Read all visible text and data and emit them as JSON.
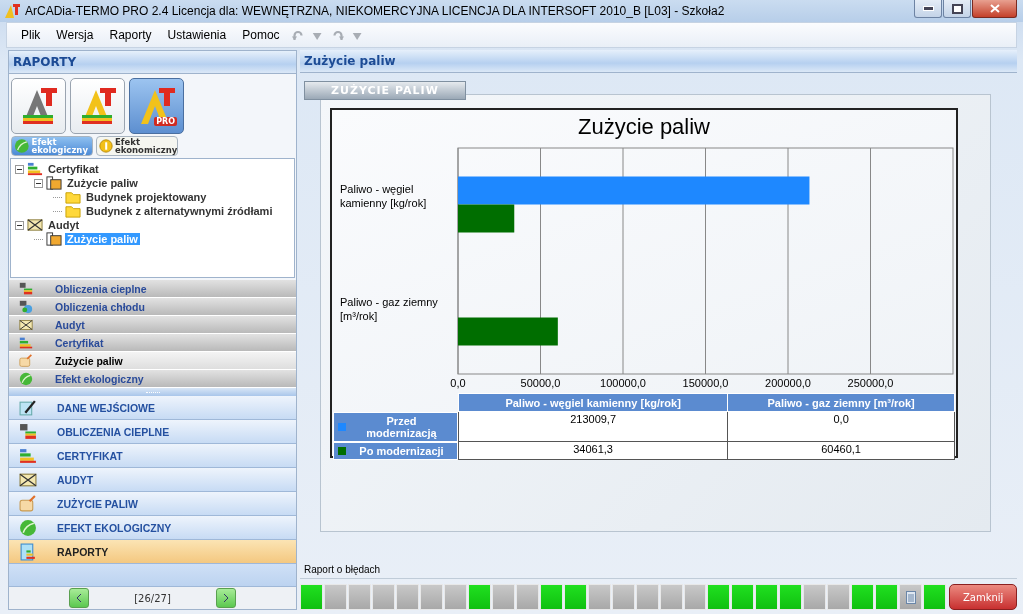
{
  "window": {
    "title": "ArCADia-TERMO PRO 2.4 Licencja dla: WEWNĘTRZNA, NIEKOMERCYJNA LICENCJA DLA INTERSOFT 2010_B [L03] - Szkoła2"
  },
  "menu": [
    "Plik",
    "Wersja",
    "Raporty",
    "Ustawienia",
    "Pomoc"
  ],
  "toolbar": [
    {
      "kind": "undo",
      "disabled": true
    },
    {
      "kind": "dropdown",
      "disabled": true
    },
    {
      "kind": "redo",
      "disabled": true
    },
    {
      "kind": "dropdown",
      "disabled": true
    }
  ],
  "sidebar": {
    "title": "RAPORTY",
    "modules": [
      {
        "kind": "basic",
        "selected": false
      },
      {
        "kind": "color",
        "selected": false
      },
      {
        "kind": "pro",
        "badge": "PRO",
        "selected": true
      }
    ],
    "effect_tabs": [
      {
        "label": "Efekt ekologiczny",
        "kind": "leaf",
        "selected": true
      },
      {
        "label": "Efekt ekonomiczny",
        "kind": "coin",
        "selected": false
      }
    ],
    "tree": [
      {
        "label": "Certyfikat",
        "kind": "rating",
        "expanded": true,
        "selected": false,
        "children": [
          {
            "label": "Zużycie paliw",
            "kind": "document",
            "expanded": true,
            "selected": false,
            "children": [
              {
                "label": "Budynek projektowany",
                "kind": "folder",
                "selected": false
              },
              {
                "label": "Budynek z alternatywnymi źródłami",
                "kind": "folder",
                "selected": false
              }
            ]
          }
        ]
      },
      {
        "label": "Audyt",
        "kind": "audit",
        "expanded": true,
        "selected": false,
        "children": [
          {
            "label": "Zużycie paliw",
            "kind": "document",
            "selected": true
          }
        ]
      }
    ],
    "report_groups": [
      {
        "label": "Obliczenia cieplne",
        "kind": "heat",
        "selected": false
      },
      {
        "label": "Obliczenia chłodu",
        "kind": "cold",
        "selected": false
      },
      {
        "label": "Audyt",
        "kind": "audit",
        "selected": false
      },
      {
        "label": "Certyfikat",
        "kind": "rating",
        "selected": false
      },
      {
        "label": "Zużycie paliw",
        "kind": "fuel",
        "selected": true
      },
      {
        "label": "Efekt ekologiczny",
        "kind": "leaf",
        "selected": false
      }
    ],
    "nav": [
      {
        "label": "DANE WEJŚCIOWE",
        "kind": "pencil",
        "selected": false
      },
      {
        "label": "OBLICZENIA CIEPLNE",
        "kind": "heat",
        "selected": false
      },
      {
        "label": "CERTYFIKAT",
        "kind": "rating",
        "selected": false
      },
      {
        "label": "AUDYT",
        "kind": "audit",
        "selected": false
      },
      {
        "label": "ZUŻYCIE PALIW",
        "kind": "fuel",
        "selected": false
      },
      {
        "label": "EFEKT EKOLOGICZNY",
        "kind": "leaf",
        "selected": false
      },
      {
        "label": "RAPORTY",
        "kind": "report",
        "selected": true
      }
    ],
    "pager": {
      "position": "[26/27]"
    }
  },
  "report": {
    "title": "Zużycie paliw",
    "tab": "ZUŻYCIE PALIW",
    "chart_data": {
      "type": "bar",
      "orientation": "horizontal",
      "title": "Zużycie paliw",
      "categories": [
        "Paliwo - węgiel kamienny [kg/rok]",
        "Paliwo - gaz ziemny [m³/rok]"
      ],
      "series": [
        {
          "name": "Przed modernizacją",
          "color": "#1e88ff",
          "values": [
            213000,
            0
          ]
        },
        {
          "name": "Po modernizacji",
          "color": "#006e00",
          "values": [
            34100,
            60500
          ]
        }
      ],
      "xlim": [
        0,
        300000
      ],
      "grid": true,
      "xticks": [
        {
          "value": 0,
          "label": "0,0"
        },
        {
          "value": 50000,
          "label": "50000,0"
        },
        {
          "value": 100000,
          "label": "100000,0"
        },
        {
          "value": 150000,
          "label": "150000,0"
        },
        {
          "value": 200000,
          "label": "200000,0"
        },
        {
          "value": 250000,
          "label": "250000,0"
        }
      ]
    },
    "data_table": {
      "columns": [
        "Paliwo - węgiel kamienny [kg/rok]",
        "Paliwo - gaz ziemny [m³/rok]"
      ],
      "rows": [
        {
          "cells": [
            "213009,7",
            "0,0"
          ]
        },
        {
          "cells": [
            "34061,3",
            "60460,1"
          ]
        }
      ]
    }
  },
  "error_report": {
    "label": "Raport o błędach"
  },
  "status_cells": [
    {
      "kind": "ok"
    },
    {
      "kind": "empty"
    },
    {
      "kind": "empty"
    },
    {
      "kind": "empty"
    },
    {
      "kind": "empty"
    },
    {
      "kind": "empty"
    },
    {
      "kind": "empty"
    },
    {
      "kind": "ok"
    },
    {
      "kind": "empty"
    },
    {
      "kind": "empty"
    },
    {
      "kind": "ok"
    },
    {
      "kind": "ok"
    },
    {
      "kind": "empty"
    },
    {
      "kind": "empty"
    },
    {
      "kind": "empty"
    },
    {
      "kind": "empty"
    },
    {
      "kind": "empty"
    },
    {
      "kind": "ok"
    },
    {
      "kind": "ok"
    },
    {
      "kind": "ok"
    },
    {
      "kind": "ok"
    },
    {
      "kind": "empty"
    },
    {
      "kind": "empty"
    },
    {
      "kind": "ok"
    },
    {
      "kind": "ok"
    },
    {
      "kind": "document"
    },
    {
      "kind": "ok"
    }
  ],
  "close_button": "Zamknij"
}
